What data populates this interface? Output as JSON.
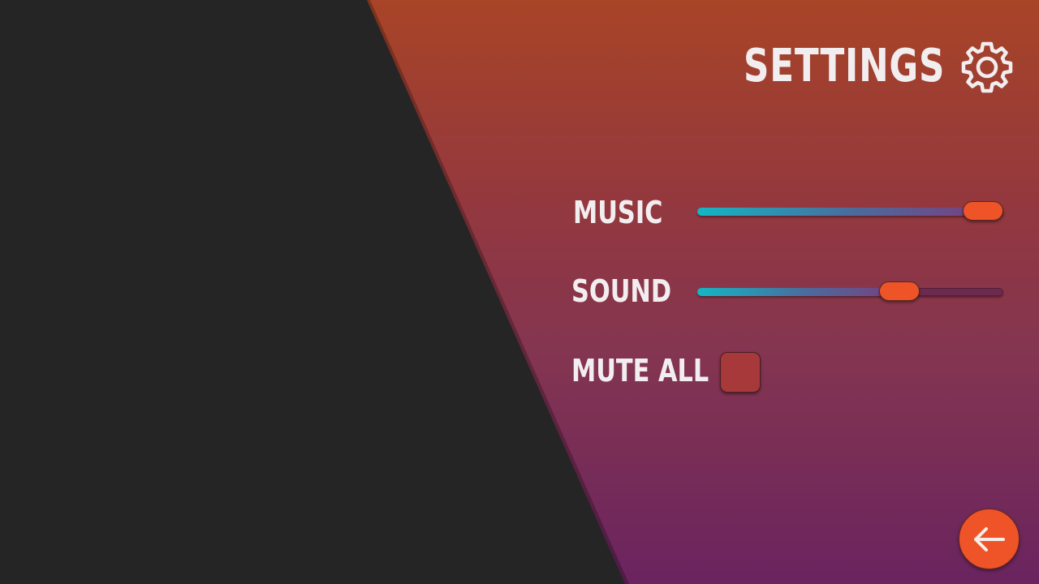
{
  "header": {
    "title": "SETTINGS",
    "icon": "gear-icon"
  },
  "settings": {
    "music": {
      "label": "MUSIC",
      "level": 0.94
    },
    "sound": {
      "label": "SOUND",
      "level": 0.66
    },
    "mute_all": {
      "label": "MUTE ALL",
      "checked": false
    }
  },
  "back_button": {
    "icon": "arrow-left-icon"
  },
  "colors": {
    "accent": "#ee5428",
    "slider_fill_start": "#14b6c4",
    "slider_track": "#6e2a4e",
    "checkbox": "#a8393a",
    "panel_dark": "#252525",
    "background_top": "#a84427",
    "background_bottom": "#6a245f",
    "text": "#f2eef0"
  }
}
